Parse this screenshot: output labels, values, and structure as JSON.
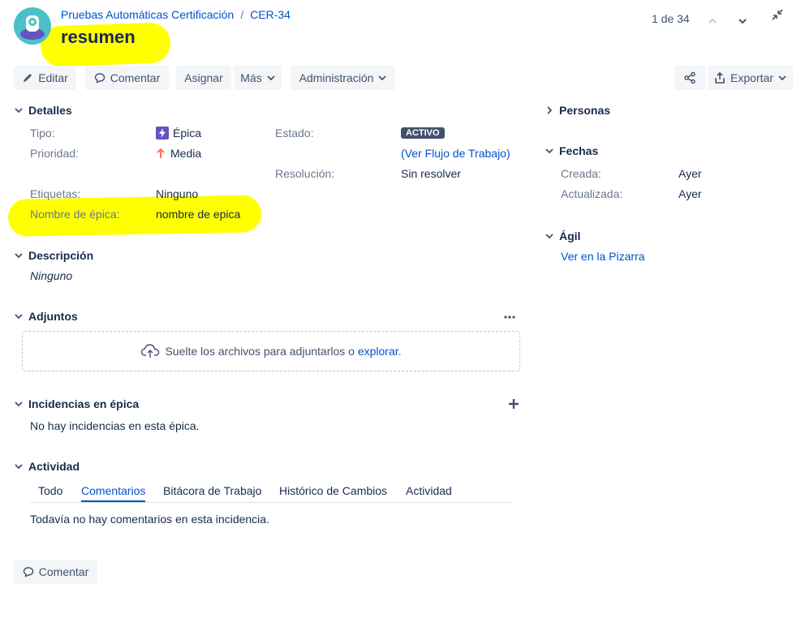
{
  "breadcrumb": {
    "project": "Pruebas Automáticas Certificación",
    "separator": "/",
    "issue_key": "CER-34"
  },
  "summary": "resumen",
  "pager": {
    "position": "1 de 34"
  },
  "toolbar": {
    "edit_label": "Editar",
    "comment_label": "Comentar",
    "assign_label": "Asignar",
    "more_label": "Más",
    "admin_label": "Administración",
    "export_label": "Exportar"
  },
  "details": {
    "title": "Detalles",
    "type_label": "Tipo:",
    "type_value": "Épica",
    "priority_label": "Prioridad:",
    "priority_value": "Media",
    "status_label": "Estado:",
    "status_value": "ACTIVO",
    "workflow_open": "(",
    "workflow_link": "Ver Flujo de Trabajo",
    "workflow_close": ")",
    "resolution_label": "Resolución:",
    "resolution_value": "Sin resolver",
    "labels_label": "Etiquetas:",
    "labels_value": "Ninguno",
    "epic_name_label": "Nombre de épica:",
    "epic_name_value": "nombre de epica"
  },
  "description": {
    "title": "Descripción",
    "value": "Ninguno"
  },
  "attachments": {
    "title": "Adjuntos",
    "drop_text": "Suelte los archivos para adjuntarlos o ",
    "browse_link": "explorar",
    "drop_end": "."
  },
  "epic_issues": {
    "title": "Incidencias en épica",
    "empty": "No hay incidencias en esta épica."
  },
  "activity": {
    "title": "Actividad",
    "tabs": [
      "Todo",
      "Comentarios",
      "Bitácora de Trabajo",
      "Histórico de Cambios",
      "Actividad"
    ],
    "active_tab": "Comentarios",
    "empty": "Todavía no hay comentarios en esta incidencia."
  },
  "bottom_comment_label": "Comentar",
  "people": {
    "title": "Personas"
  },
  "dates": {
    "title": "Fechas",
    "created_label": "Creada:",
    "created_value": "Ayer",
    "updated_label": "Actualizada:",
    "updated_value": "Ayer"
  },
  "agile": {
    "title": "Ágil",
    "board_link": "Ver en la Pizarra"
  },
  "colors": {
    "link": "#0052cc",
    "status_bg": "#42526e",
    "epic": "#6554c0",
    "priority": "#ff7452",
    "highlight": "#ffff00"
  }
}
